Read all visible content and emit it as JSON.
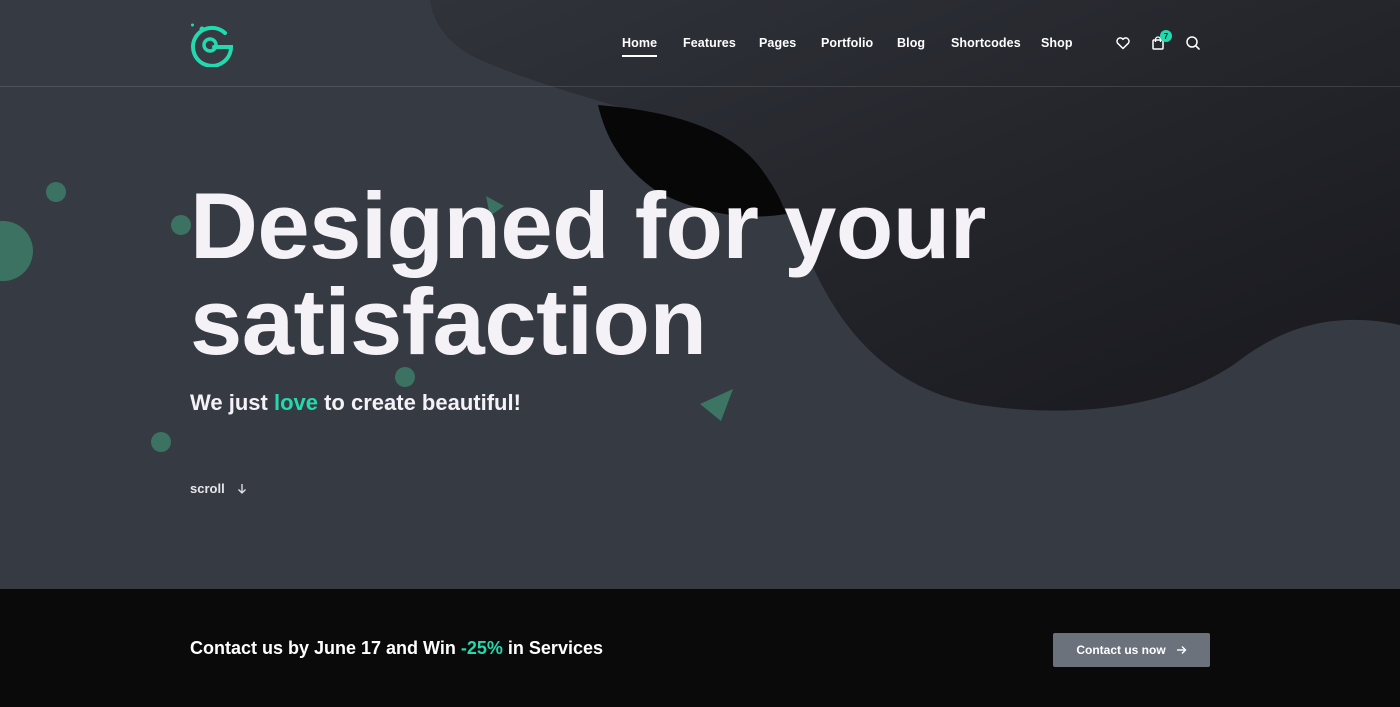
{
  "colors": {
    "background": "#363a42",
    "accent": "#23d9ae",
    "dark_wave": "#1b1c21",
    "cta_bar": "#0a0a0b",
    "cta_button": "#6b727c"
  },
  "header": {
    "logo": "g-circuit-logo-icon",
    "nav": [
      {
        "label": "Home",
        "active": true
      },
      {
        "label": "Features"
      },
      {
        "label": "Pages"
      },
      {
        "label": "Portfolio"
      },
      {
        "label": "Blog"
      },
      {
        "label": "Shortcodes"
      },
      {
        "label": "Shop"
      }
    ],
    "icons": [
      "heart-icon",
      "shopping-bag-icon",
      "search-icon"
    ],
    "cart_count": "7"
  },
  "hero": {
    "headline_line1": "Designed for your",
    "headline_line2": "satisfaction",
    "tagline_before": "We just ",
    "tagline_accent": "love",
    "tagline_after": " to create beautiful!",
    "scroll_label": "scroll",
    "scroll_icon": "arrow-down-icon"
  },
  "cta": {
    "text_before": "Contact us by June 17 and Win ",
    "text_accent": "-25%",
    "text_after": " in Services",
    "button_label": "Contact us now",
    "button_icon": "arrow-right-icon"
  }
}
